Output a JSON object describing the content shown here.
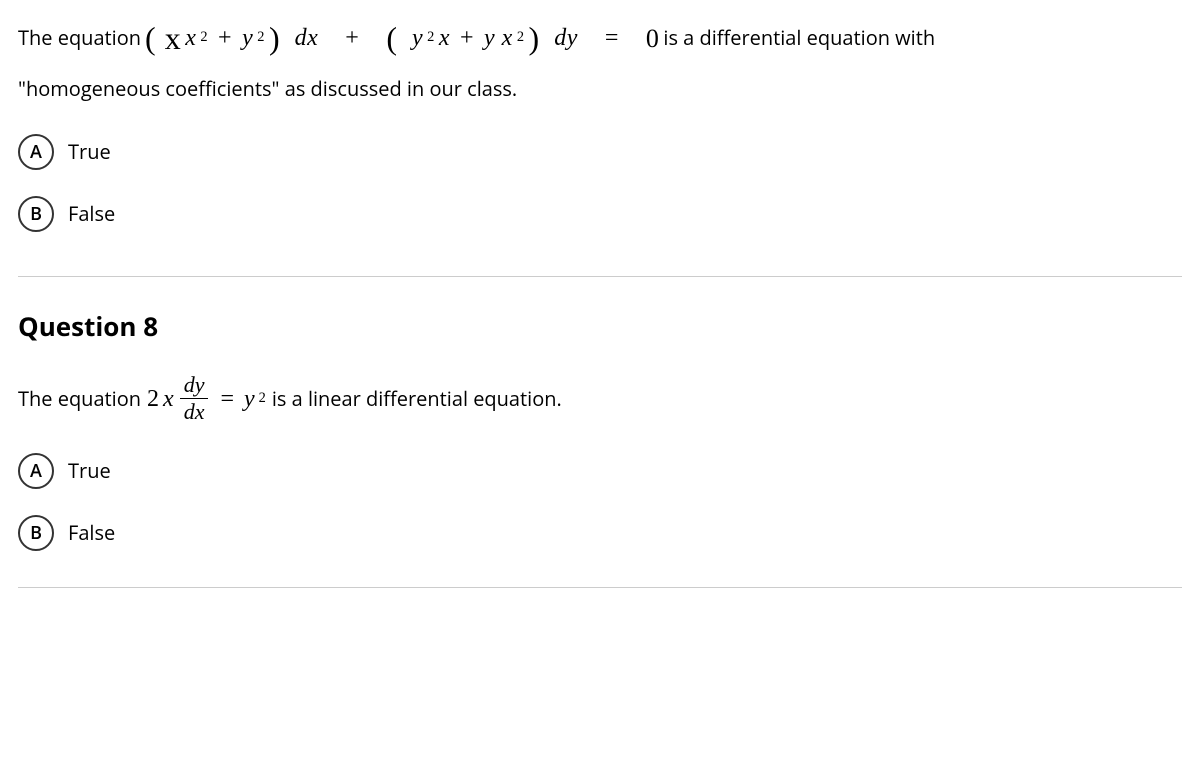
{
  "q7": {
    "text_before": "The equation",
    "eq_part1_a": "( x",
    "eq_part1_a_sup": "2",
    "eq_plus1": "+",
    "eq_part1_b": "y",
    "eq_part1_b_sup": "2",
    "eq_part1_close": ")",
    "eq_dx": "dx",
    "eq_plus2": "+",
    "eq_part2_open": "(",
    "eq_part2_a": "y",
    "eq_part2_a_sup": "2",
    "eq_part2_x": "x",
    "eq_plus3": "+",
    "eq_part2_b": "y x",
    "eq_part2_b_sup": "2",
    "eq_part2_close": ")",
    "eq_dy": "dy",
    "eq_equals": "=",
    "eq_zero": "0",
    "text_after1": "is a differential equation with",
    "text_after2": "\"homogeneous coefficients\" as discussed in our class.",
    "optA_letter": "A",
    "optA_label": "True",
    "optB_letter": "B",
    "optB_label": "False"
  },
  "q8": {
    "heading": "Question 8",
    "text_before": "The equation",
    "eq_2x": "2x",
    "frac_num": "dy",
    "frac_den": "dx",
    "eq_equals": "=",
    "eq_y": "y",
    "eq_y_sup": "2",
    "text_after": "is a linear differential equation.",
    "optA_letter": "A",
    "optA_label": "True",
    "optB_letter": "B",
    "optB_label": "False"
  }
}
